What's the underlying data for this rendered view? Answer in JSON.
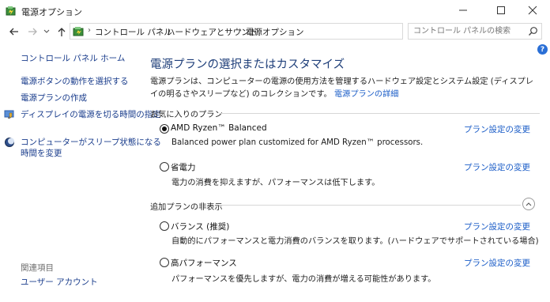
{
  "window": {
    "title": "電源オプション",
    "app_icon": "power-options-icon"
  },
  "navigation": {
    "back_icon": "arrow-left-icon",
    "forward_icon": "arrow-right-icon",
    "recent_icon": "chevron-down-icon",
    "up_icon": "arrow-up-icon",
    "breadcrumb": [
      "コントロール パネル",
      "ハードウェアとサウンド",
      "電源オプション"
    ],
    "search_placeholder": "コントロール パネルの検索"
  },
  "sidebar": {
    "home": "コントロール パネル ホーム",
    "links": [
      {
        "label": "電源ボタンの動作を選択する"
      },
      {
        "label": "電源プランの作成"
      },
      {
        "label": "ディスプレイの電源を切る時間の指定",
        "icon": "monitor-shield-icon"
      },
      {
        "label_line1": "コンピューターがスリープ状態になる",
        "label_line2": "時間を変更",
        "icon": "moon-icon"
      }
    ],
    "see_also_heading": "関連項目",
    "see_also": [
      "ユーザー アカウント"
    ]
  },
  "main": {
    "title": "電源プランの選択またはカスタマイズ",
    "description": "電源プランは、コンピューターの電源の使用方法を管理するハードウェア設定とシステム設定 (ディスプレイの明るさやスリープなど) のコレクションです。",
    "details_link": "電源プランの詳細",
    "favorites_heading": "お気に入りのプラン",
    "hidden_heading": "追加プランの非表示",
    "change_label": "プラン設定の変更",
    "plans": [
      {
        "name": "AMD Ryzen™ Balanced",
        "description": "Balanced power plan customized for AMD Ryzen™ processors.",
        "selected": true
      },
      {
        "name": "省電力",
        "description": "電力の消費を抑えますが、パフォーマンスは低下します。",
        "selected": false
      },
      {
        "name": "バランス (推奨)",
        "description": "自動的にパフォーマンスと電力消費のバランスを取ります。(ハードウェアでサポートされている場合)",
        "selected": false
      },
      {
        "name": "高パフォーマンス",
        "description": "パフォーマンスを優先しますが、電力の消費が増える可能性があります。",
        "selected": false
      }
    ]
  },
  "colors": {
    "link": "#1a5cc7",
    "sidebar_link": "#1a3d8c",
    "heading": "#1f3f7a"
  }
}
